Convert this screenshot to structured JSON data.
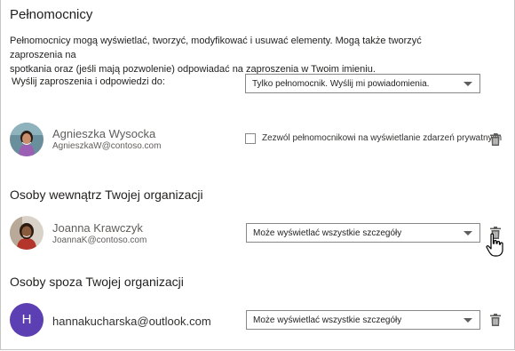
{
  "header": {
    "title": "Pełnomocnicy"
  },
  "description": {
    "line1": "Pełnomocnicy mogą wyświetlać, tworzyć, modyfikować i usuwać elementy. Mogą także tworzyć zaproszenia na",
    "line2": "spotkania oraz (jeśli mają pozwolenie) odpowiadać na zaproszenia w Twoim imieniu."
  },
  "send_setting": {
    "label": "Wyślij zaproszenia i odpowiedzi do:",
    "selected": "Tylko pełnomocnik. Wyślij mi powiadomienia."
  },
  "delegate": {
    "name": "Agnieszka Wysocka",
    "email": "AgnieszkaW@contoso.com",
    "checkbox_label": "Zezwól pełnomocnikowi na wyświetlanie zdarzeń prywatnych",
    "checked": false
  },
  "internal": {
    "heading": "Osoby wewnątrz Twojej organizacji",
    "person": {
      "name": "Joanna Krawczyk",
      "email": "JoannaK@contoso.com",
      "permission": "Może wyświetlać wszystkie szczegóły"
    }
  },
  "external": {
    "heading": "Osoby spoza Twojej organizacji",
    "person": {
      "initial": "H",
      "email": "hannakucharska@outlook.com",
      "permission": "Może wyświetlać wszystkie szczegóły"
    }
  },
  "colors": {
    "initial_avatar": "#5b3fb3",
    "trash_icon": "#605e5c"
  },
  "icons": {
    "trash": "trash-icon",
    "cursor": "hand-cursor-icon"
  }
}
